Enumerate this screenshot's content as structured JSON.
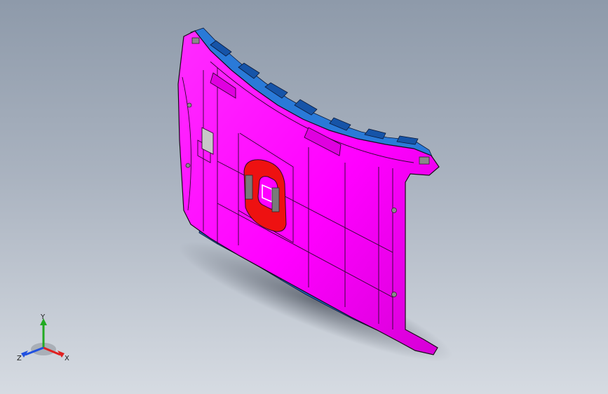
{
  "viewport": {
    "background_top": "#8e9aaa",
    "background_bottom": "#d6dbe2"
  },
  "model": {
    "part_color": "#ff00ff",
    "edge_color": "#1a0a1a",
    "clip_color": "#1f6fc6",
    "region_color": "#ee1111",
    "pad_color": "#7a7a7a"
  },
  "triad": {
    "icon": "coordinate-triad-icon",
    "y_label": "Y",
    "x_label": "X",
    "z_label": "Z",
    "y_color": "#22aa22",
    "x_color": "#e02020",
    "z_color": "#2050e0"
  }
}
